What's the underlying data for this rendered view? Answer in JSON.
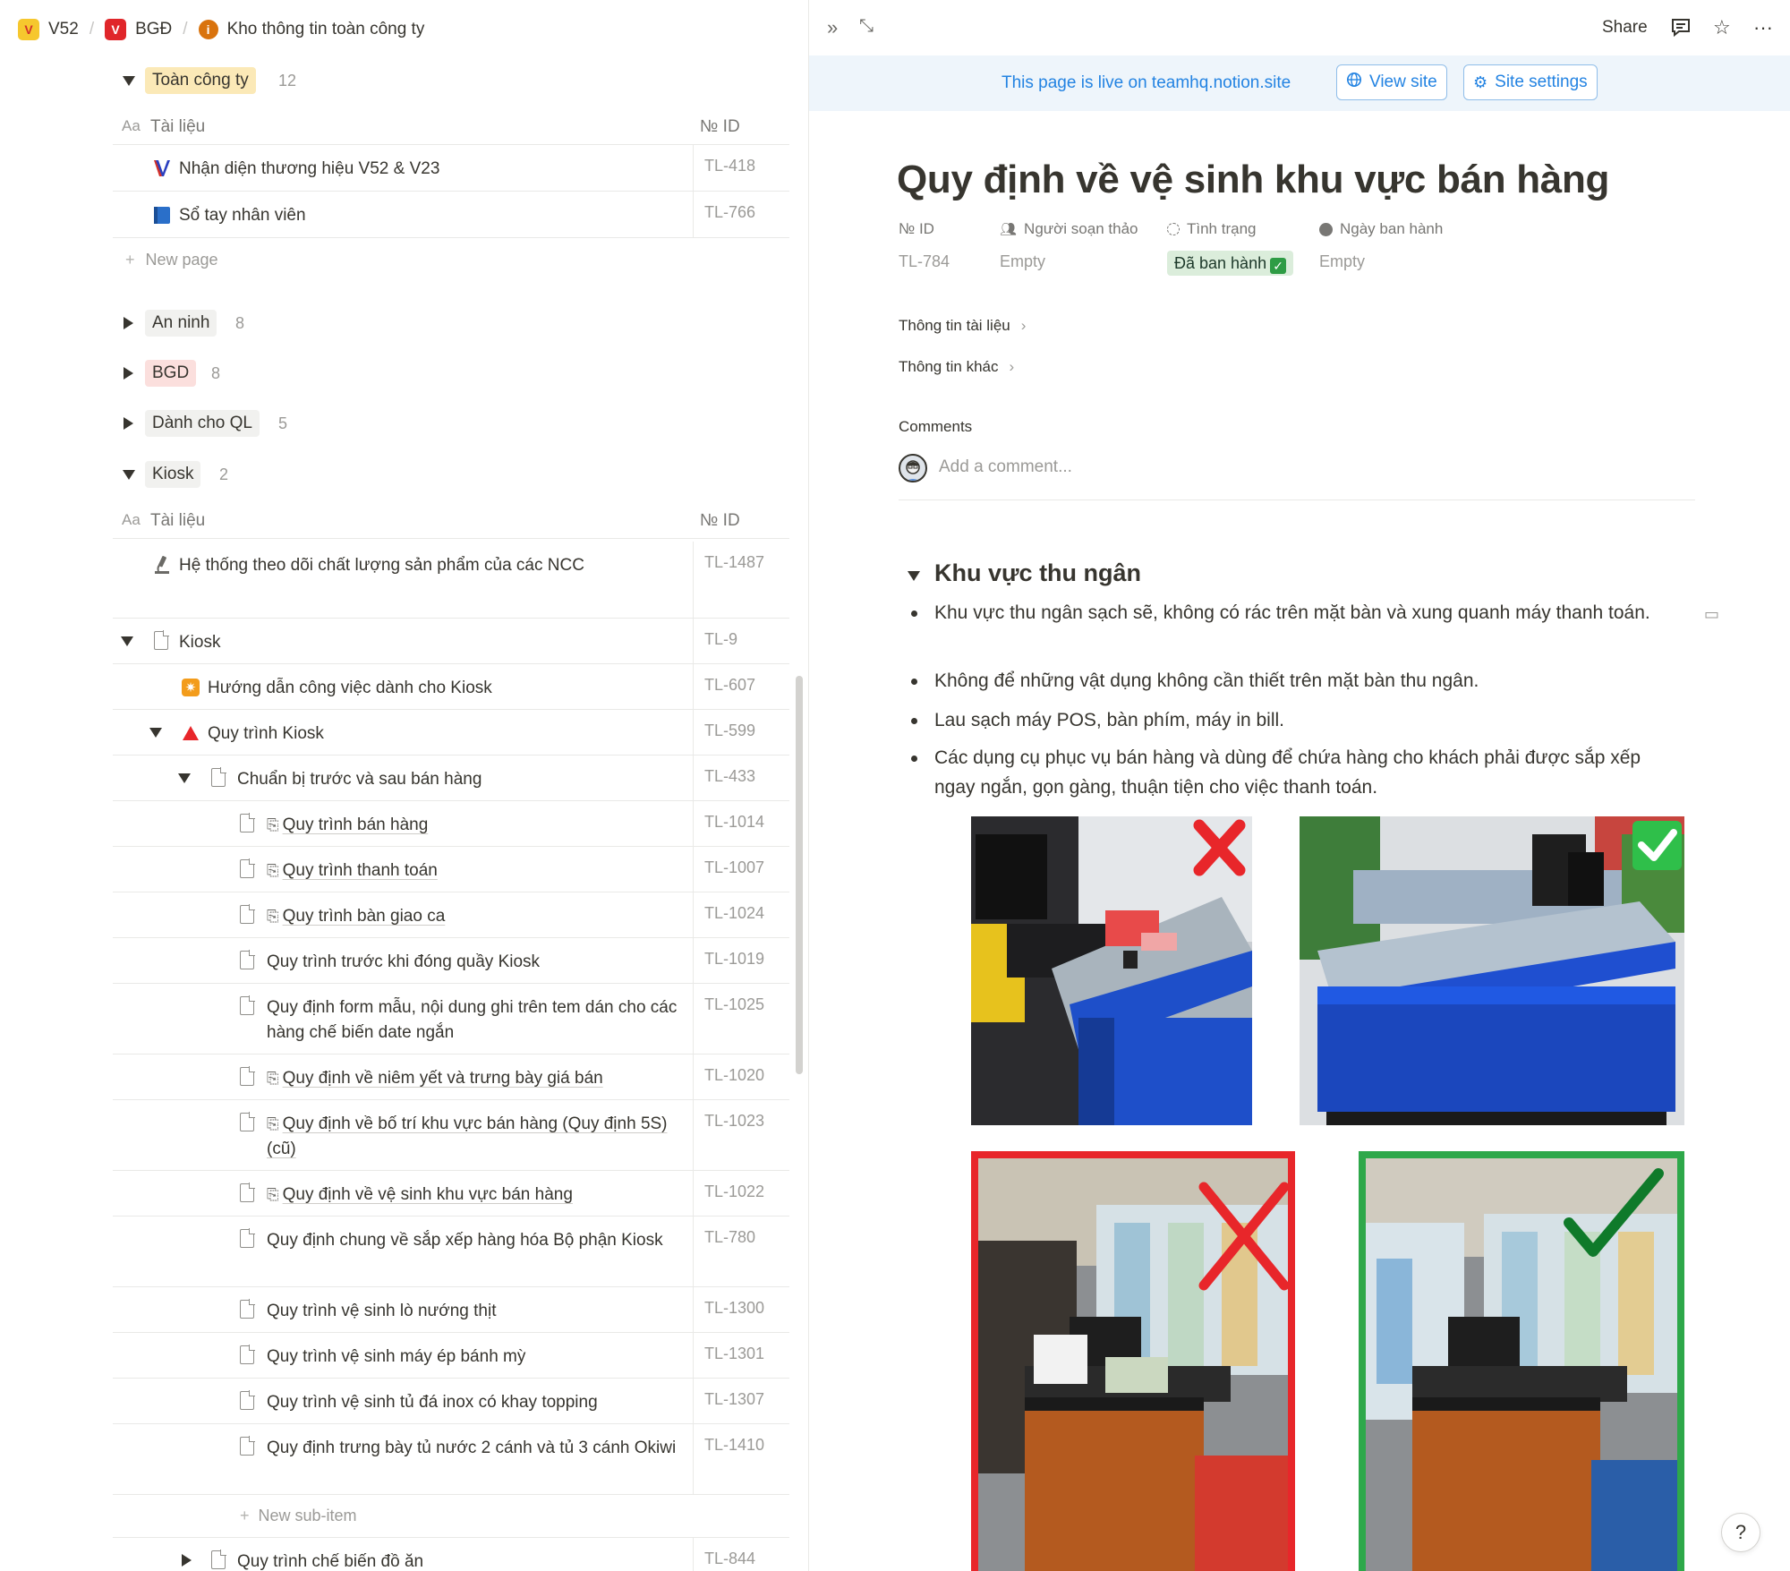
{
  "breadcrumb": [
    "V52",
    "BGĐ",
    "Kho thông tin toàn công ty"
  ],
  "groups": {
    "toan_cong_ty": {
      "label": "Toàn công ty",
      "count": "12",
      "color": "#fbe9b7"
    },
    "an_ninh": {
      "label": "An ninh",
      "count": "8",
      "color": "#f1f1ef"
    },
    "bgd": {
      "label": "BGD",
      "count": "8",
      "color": "#fbdfdd"
    },
    "danh_cho_ql": {
      "label": "Dành cho QL",
      "count": "5",
      "color": "#f1f1ef"
    },
    "kiosk": {
      "label": "Kiosk",
      "count": "2",
      "color": "#f1f1ef"
    }
  },
  "columns": {
    "title_icon": "Aa",
    "title": "Tài liệu",
    "id": "№ ID"
  },
  "toan_rows": [
    {
      "title": "Nhận diện thương hiệu V52 & V23",
      "id": "TL-418",
      "icon": "v52-logo-icon"
    },
    {
      "title": "Sổ tay nhân viên",
      "id": "TL-766",
      "icon": "book-icon"
    }
  ],
  "new_page": "New page",
  "kiosk_rows": [
    {
      "title": "Hệ thống theo dõi chất lượng sản phẩm của các NCC",
      "id": "TL-1487",
      "icon": "microscope-icon"
    },
    {
      "title": "Kiosk",
      "id": "TL-9",
      "icon": "page-icon"
    },
    {
      "title": "Hướng dẫn công việc dành cho Kiosk",
      "id": "TL-607",
      "icon": "starburst-icon"
    },
    {
      "title": "Quy trình Kiosk",
      "id": "TL-599",
      "icon": "red-triangle-icon"
    },
    {
      "title": "Chuẩn bị trước và sau bán hàng",
      "id": "TL-433",
      "icon": "page-icon"
    },
    {
      "title": "Quy trình bán hàng",
      "id": "TL-1014",
      "icon": "page-link-icon"
    },
    {
      "title": "Quy trình thanh toán",
      "id": "TL-1007",
      "icon": "page-link-icon"
    },
    {
      "title": "Quy trình bàn giao ca",
      "id": "TL-1024",
      "icon": "page-link-icon"
    },
    {
      "title": "Quy trình trước khi đóng quầy Kiosk",
      "id": "TL-1019",
      "icon": "page-icon"
    },
    {
      "title": "Quy định form mẫu, nội dung ghi trên tem dán cho các hàng chế biến date ngắn",
      "id": "TL-1025",
      "icon": "page-icon"
    },
    {
      "title": "Quy định về niêm yết và trưng bày giá bán",
      "id": "TL-1020",
      "icon": "page-link-icon"
    },
    {
      "title": "Quy định về bố trí khu vực bán hàng (Quy định 5S)(cũ)",
      "id": "TL-1023",
      "icon": "page-link-icon"
    },
    {
      "title": "Quy định về vệ sinh khu vực bán hàng",
      "id": "TL-1022",
      "icon": "page-link-icon"
    },
    {
      "title": "Quy định chung về sắp xếp hàng hóa Bộ phận Kiosk",
      "id": "TL-780",
      "icon": "page-icon"
    },
    {
      "title": "Quy trình vệ sinh lò nướng thịt",
      "id": "TL-1300",
      "icon": "page-icon"
    },
    {
      "title": "Quy trình vệ sinh máy ép bánh mỳ",
      "id": "TL-1301",
      "icon": "page-icon"
    },
    {
      "title": "Quy trình vệ sinh tủ đá inox có khay topping",
      "id": "TL-1307",
      "icon": "page-icon"
    },
    {
      "title": "Quy định trưng bày tủ nước 2 cánh và tủ 3 cánh Okiwi",
      "id": "TL-1410",
      "icon": "page-icon"
    },
    {
      "title": "Quy trình chế biến đồ ăn",
      "id": "TL-844",
      "icon": "page-icon"
    }
  ],
  "new_sub_item": "New sub-item",
  "topbar": {
    "share": "Share"
  },
  "banner": {
    "text": "This page is live on teamhq.notion.site",
    "view_site": "View site",
    "site_settings": "Site settings"
  },
  "page": {
    "title": "Quy định về vệ sinh khu vực bán hàng",
    "properties": {
      "id_label": "№ ID",
      "id_value": "TL-784",
      "author_label": "Người soạn thảo",
      "author_value": "Empty",
      "status_label": "Tình trạng",
      "status_value": "Đã ban hành",
      "date_label": "Ngày ban hành",
      "date_value": "Empty"
    },
    "sections": [
      "Thông tin tài liệu",
      "Thông tin khác"
    ],
    "comments_label": "Comments",
    "comment_placeholder": "Add a comment...",
    "toggle_heading": "Khu vực thu ngân",
    "bullets": [
      "Khu vực thu ngân sạch sẽ, không có rác trên mặt bàn và xung quanh máy thanh toán.",
      "Không để những vật dụng không cần thiết trên mặt bàn thu ngân.",
      "Lau sạch máy POS, bàn phím, máy in bill.",
      "Các dụng cụ phục vụ bán hàng và dùng để chứa hàng cho khách phải được sắp xếp ngay ngắn, gọn gàng, thuận tiện cho việc thanh toán."
    ]
  },
  "colors": {
    "accent_blue": "#2383e2",
    "status_green": "#dbeddb",
    "wrong_red": "#e8262a",
    "right_green": "#2ea84a"
  }
}
